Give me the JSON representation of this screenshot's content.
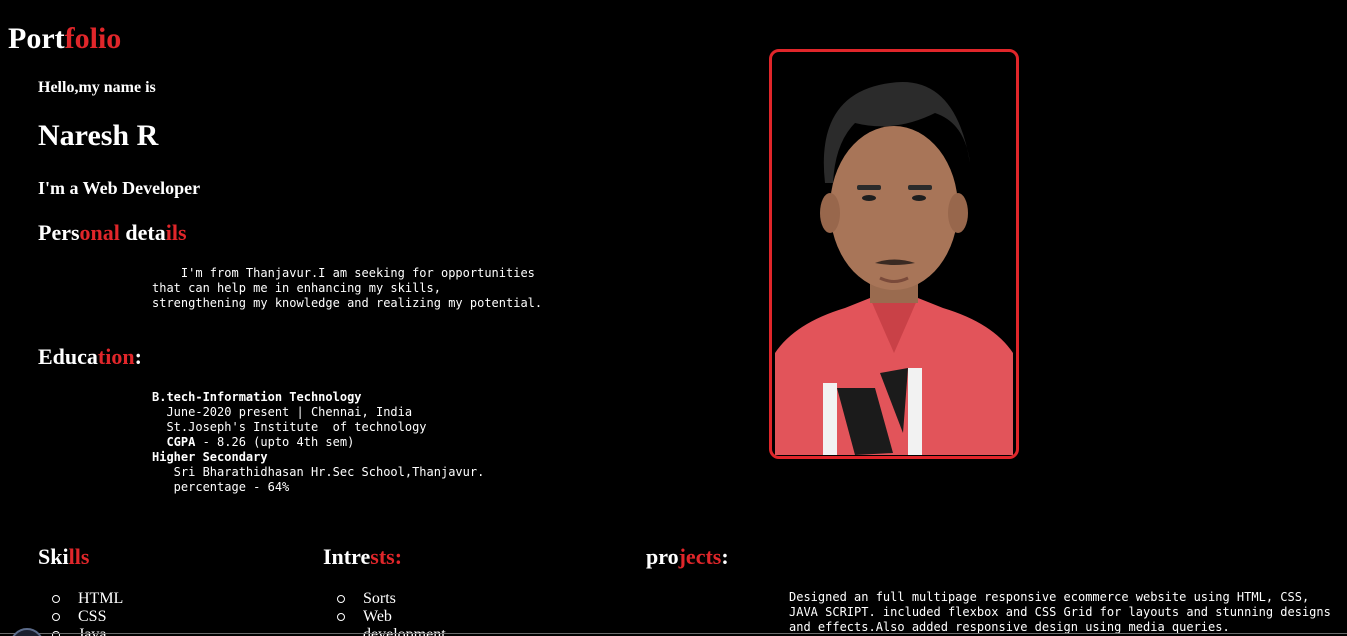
{
  "header": {
    "logo_white": "Port",
    "logo_red": "folio"
  },
  "intro": {
    "hello": "Hello,my name is",
    "name": "Naresh R",
    "role": "I'm a Web Developer"
  },
  "personal": {
    "heading_p1": "Pers",
    "heading_p2": "onal",
    "heading_p3": " deta",
    "heading_p4": "ils",
    "text": "    I'm from Thanjavur.I am seeking for opportunities\nthat can help me in enhancing my skills,\nstrengthening my knowledge and realizing my potential."
  },
  "education": {
    "heading_p1": "Educa",
    "heading_p2": "tion",
    "heading_p3": ":",
    "degree": "B.tech-Information Technology",
    "degree_period": "  June-2020 present | Chennai, India",
    "degree_institute": "  St.Joseph's Institute  of technology",
    "cgpa_label": "CGPA",
    "cgpa_value": " - 8.26 (upto 4th sem)",
    "secondary": "Higher Secondary",
    "secondary_school": "   Sri Bharathidhasan Hr.Sec School,Thanjavur.",
    "secondary_percentage": "   percentage - 64%"
  },
  "photo": {
    "icon": "profile-photo",
    "border_color": "#e0262a"
  },
  "skills": {
    "heading_p1": "Ski",
    "heading_p2": "lls",
    "items": [
      "HTML",
      "CSS",
      "Java"
    ]
  },
  "interests": {
    "heading_p1": "Intre",
    "heading_p2": "sts:",
    "items": [
      "Sorts",
      "Web",
      "development"
    ]
  },
  "projects": {
    "heading_p1": "pro",
    "heading_p2": "jects",
    "heading_p3": ":",
    "description": "Designed an full multipage responsive ecommerce website using HTML, CSS, JAVA SCRIPT. included flexbox and CSS Grid for layouts and stunning designs and effects.Also added responsive design using media queries."
  },
  "colors": {
    "accent": "#e0262a",
    "background": "#000000",
    "text": "#ffffff"
  }
}
